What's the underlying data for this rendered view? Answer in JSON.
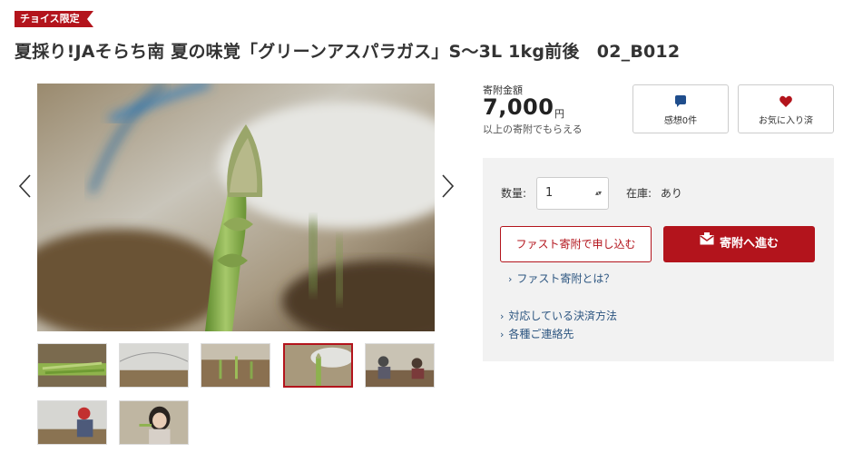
{
  "badge": {
    "label": "チョイス限定"
  },
  "product": {
    "title": "夏採り!JAそらち南 夏の味覚「グリーンアスパラガス」S〜3L 1kg前後　02_B012"
  },
  "price": {
    "label": "寄附金額",
    "value": "7,000",
    "unit": "円",
    "note": "以上の寄附でもらえる"
  },
  "actions": {
    "review": {
      "label": "感想0件",
      "icon": "speech-bubble-icon"
    },
    "favorite": {
      "label": "お気に入り済",
      "icon": "heart-icon"
    }
  },
  "order": {
    "quantity_label": "数量:",
    "quantity_value": "1",
    "stock_label": "在庫:",
    "stock_value": "あり",
    "fast_button": "ファスト寄附で申し込む",
    "donate_button": "寄附へ進む",
    "fast_link": "ファスト寄附とは？",
    "payment_link": "対応している決済方法",
    "contact_link": "各種ご連絡先"
  },
  "gallery": {
    "thumbnails": [
      {
        "alt": "asparagus-bundle"
      },
      {
        "alt": "greenhouse"
      },
      {
        "alt": "asparagus-sprouts"
      },
      {
        "alt": "asparagus-closeup",
        "active": true
      },
      {
        "alt": "farmers-harvesting"
      },
      {
        "alt": "farmer-in-greenhouse"
      },
      {
        "alt": "girl-with-asparagus"
      }
    ]
  },
  "colors": {
    "accent": "#b3141c",
    "link": "#2c5580",
    "panel": "#f2f2f2"
  }
}
